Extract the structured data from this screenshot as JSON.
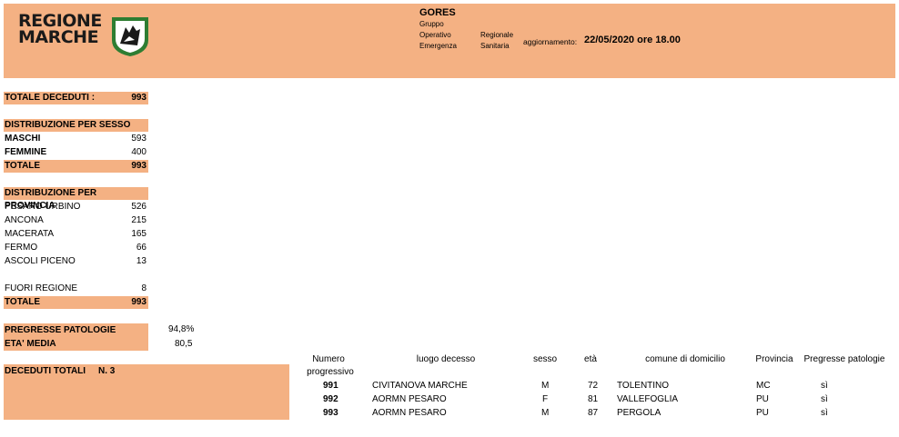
{
  "header": {
    "logo_line1": "REGIONE",
    "logo_line2": "MARCHE",
    "title": "GORES",
    "org_col1": [
      "Gruppo",
      "Operativo",
      "Emergenza"
    ],
    "org_col2": [
      "Regionale",
      "Sanitaria"
    ],
    "update_label": "aggiornamento:",
    "update_value": "22/05/2020 ore 18.00"
  },
  "totals": {
    "deceased_label": "TOTALE DECEDUTI :",
    "deceased_value": "993"
  },
  "by_sex": {
    "title": "DISTRIBUZIONE PER SESSO",
    "rows": [
      {
        "label": "MASCHI",
        "value": "593"
      },
      {
        "label": "FEMMINE",
        "value": "400"
      }
    ],
    "total_label": "TOTALE",
    "total_value": "993"
  },
  "by_province": {
    "title": "DISTRIBUZIONE PER PROVINCIA",
    "rows": [
      {
        "label": "PESARO URBINO",
        "value": "526"
      },
      {
        "label": "ANCONA",
        "value": "215"
      },
      {
        "label": "MACERATA",
        "value": "165"
      },
      {
        "label": "FERMO",
        "value": "66"
      },
      {
        "label": "ASCOLI PICENO",
        "value": "13"
      }
    ],
    "outside_label": "FUORI REGIONE",
    "outside_value": "8",
    "total_label": "TOTALE",
    "total_value": "993"
  },
  "stats": {
    "pathologies_label": "PREGRESSE PATOLOGIE",
    "pathologies_value": "94,8%",
    "age_label": "ETA' MEDIA",
    "age_value": "80,5"
  },
  "daily": {
    "label": "DECEDUTI TOTALI",
    "count": "N.  3"
  },
  "table": {
    "headers": {
      "num_line1": "Numero",
      "num_line2": "progressivo",
      "place": "luogo decesso",
      "sex": "sesso",
      "age": "età",
      "municipality": "comune di domicilio",
      "province": "Provincia",
      "pathologies": "Pregresse patologie"
    },
    "rows": [
      {
        "num": "991",
        "place": "CIVITANOVA MARCHE",
        "sex": "M",
        "age": "72",
        "municipality": "TOLENTINO",
        "province": "MC",
        "pathologies": "sì"
      },
      {
        "num": "992",
        "place": "AORMN PESARO",
        "sex": "F",
        "age": "81",
        "municipality": "VALLEFOGLIA",
        "province": "PU",
        "pathologies": "sì"
      },
      {
        "num": "993",
        "place": "AORMN PESARO",
        "sex": "M",
        "age": "87",
        "municipality": "PERGOLA",
        "province": "PU",
        "pathologies": "sì"
      }
    ]
  },
  "colors": {
    "band": "#f4b183",
    "shield_green": "#2e7d32"
  }
}
